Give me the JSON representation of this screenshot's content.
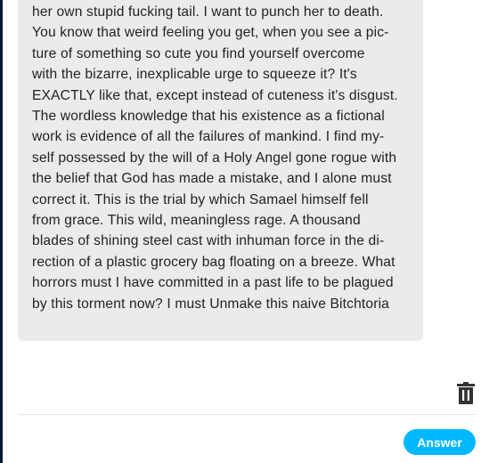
{
  "post": {
    "text": "her own stupid fucking tail. I want to punch her to death.\nYou know that weird feeling you get, when you see a pic-\nture of something so cute you find yourself overcome\nwith the bizarre, inexplicable urge to squeeze it? It's\nEXACTLY like that, except instead of cuteness it's disgust.\nThe wordless knowledge that his existence as a fictional\nwork is evidence of all the failures of mankind. I find my-\nself possessed by the will of a Holy Angel gone rogue with\nthe belief that God has made a mistake, and I alone must\ncorrect it. This is the trial by which Samael himself fell\nfrom grace. This wild, meaningless rage. A thousand\nblades of shining steel cast with inhuman force in the di-\nrection of a plastic grocery bag floating on a breeze. What\nhorrors must I have committed in a past life to be plagued\nby this torment now? I must Unmake this naive Bitchtoria"
  },
  "actions": {
    "delete_icon": "trash-icon",
    "answer_label": "Answer"
  },
  "colors": {
    "accent": "#00b8ff",
    "card_background": "#ebebeb",
    "text": "#222222",
    "left_edge": "#001935"
  }
}
